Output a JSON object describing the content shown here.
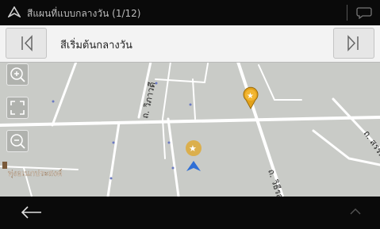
{
  "topbar": {
    "title": "สีแผนที่แบบกลางวัน (1/12)",
    "nav_icon": "navigation-arrow-icon",
    "message_icon": "chat-bubble-icon"
  },
  "style_selector": {
    "label": "สีเริ่มต้นกลางวัน",
    "prev_icon": "previous-arrow-icon",
    "next_icon": "next-arrow-icon"
  },
  "map_controls": {
    "zoom_in_icon": "zoom-in-icon",
    "fullscreen_icon": "fullscreen-icon",
    "zoom_out_icon": "zoom-out-icon"
  },
  "map": {
    "road_labels": [
      "ถ. วิภาวดี",
      "ถ. วิธีรสก",
      "ถ. สรรพ"
    ],
    "place_label": "ทุ่งอเนกประสงค์",
    "poi_icon": "star-poi-icon",
    "colors": {
      "background": "#c9cbc7",
      "road": "#ffffff",
      "poi": "#e3a21a",
      "vehicle": "#2f6fd6"
    }
  },
  "bottombar": {
    "back_icon": "back-arrow-icon",
    "up_icon": "chevron-up-icon"
  }
}
